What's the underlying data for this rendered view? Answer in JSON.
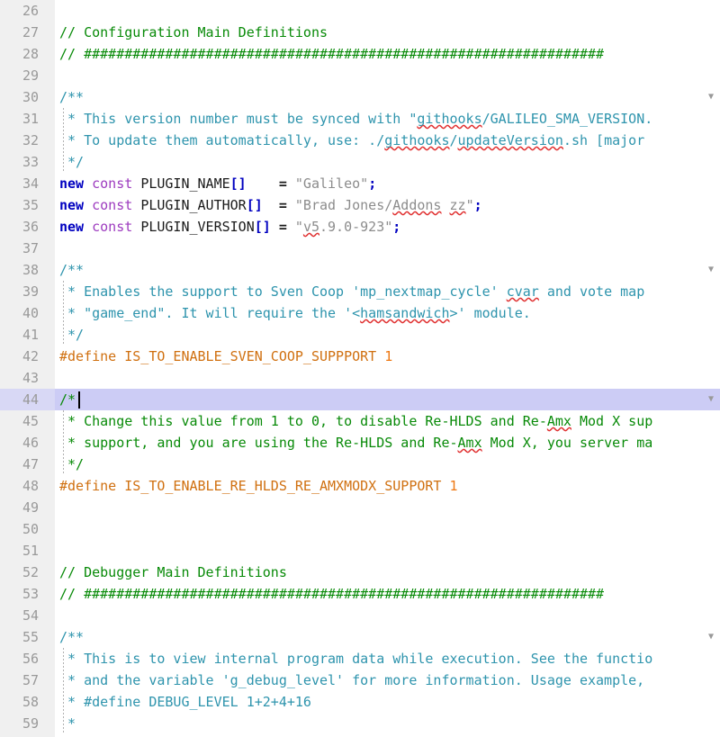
{
  "editor": {
    "name": "code-editor",
    "language": "Pawn / SourcePawn",
    "first_visible_line": 26,
    "last_visible_line": 59,
    "current_line": 44,
    "cursor": {
      "line": 44,
      "column": 3
    },
    "colors": {
      "background": "#ffffff",
      "gutter_background": "#f0f0f0",
      "gutter_text": "#999999",
      "current_line_highlight": "#ccccf5",
      "line_comment": "#088a08",
      "block_comment": "#088a08",
      "doc_comment": "#2e94ad",
      "keyword": "#0000c0",
      "const_keyword": "#9d3bbf",
      "identifier": "#1a1a1a",
      "string": "#8c8c8c",
      "preprocessor": "#d07010",
      "number": "#ee7711",
      "spellcheck_underline": "#e03030",
      "indent_guide": "#b0b0b0"
    }
  },
  "lines": [
    {
      "n": 26,
      "fold": false,
      "guide": false,
      "text": ""
    },
    {
      "n": 27,
      "fold": false,
      "guide": false,
      "text": "// Configuration Main Definitions"
    },
    {
      "n": 28,
      "fold": false,
      "guide": false,
      "text": "// ################################################################"
    },
    {
      "n": 29,
      "fold": false,
      "guide": false,
      "text": ""
    },
    {
      "n": 30,
      "fold": true,
      "guide": false,
      "text": "/**"
    },
    {
      "n": 31,
      "fold": false,
      "guide": true,
      "text": " * This version number must be synced with \"githooks/GALILEO_SMA_VERSION."
    },
    {
      "n": 32,
      "fold": false,
      "guide": true,
      "text": " * To update them automatically, use: ./githooks/updateVersion.sh [major"
    },
    {
      "n": 33,
      "fold": false,
      "guide": true,
      "text": " */"
    },
    {
      "n": 34,
      "fold": false,
      "guide": false,
      "text": "new const PLUGIN_NAME[]    = \"Galileo\";"
    },
    {
      "n": 35,
      "fold": false,
      "guide": false,
      "text": "new const PLUGIN_AUTHOR[]  = \"Brad Jones/Addons zz\";"
    },
    {
      "n": 36,
      "fold": false,
      "guide": false,
      "text": "new const PLUGIN_VERSION[] = \"v5.9.0-923\";"
    },
    {
      "n": 37,
      "fold": false,
      "guide": false,
      "text": ""
    },
    {
      "n": 38,
      "fold": true,
      "guide": false,
      "text": "/**"
    },
    {
      "n": 39,
      "fold": false,
      "guide": true,
      "text": " * Enables the support to Sven Coop 'mp_nextmap_cycle' cvar and vote map"
    },
    {
      "n": 40,
      "fold": false,
      "guide": true,
      "text": " * \"game_end\". It will require the '<hamsandwich>' module."
    },
    {
      "n": 41,
      "fold": false,
      "guide": true,
      "text": " */"
    },
    {
      "n": 42,
      "fold": false,
      "guide": false,
      "text": "#define IS_TO_ENABLE_SVEN_COOP_SUPPPORT 1"
    },
    {
      "n": 43,
      "fold": false,
      "guide": false,
      "text": ""
    },
    {
      "n": 44,
      "fold": true,
      "guide": false,
      "text": "/*"
    },
    {
      "n": 45,
      "fold": false,
      "guide": true,
      "text": " * Change this value from 1 to 0, to disable Re-HLDS and Re-Amx Mod X sup"
    },
    {
      "n": 46,
      "fold": false,
      "guide": true,
      "text": " * support, and you are using the Re-HLDS and Re-Amx Mod X, you server ma"
    },
    {
      "n": 47,
      "fold": false,
      "guide": true,
      "text": " */"
    },
    {
      "n": 48,
      "fold": false,
      "guide": false,
      "text": "#define IS_TO_ENABLE_RE_HLDS_RE_AMXMODX_SUPPORT 1"
    },
    {
      "n": 49,
      "fold": false,
      "guide": false,
      "text": ""
    },
    {
      "n": 50,
      "fold": false,
      "guide": false,
      "text": ""
    },
    {
      "n": 51,
      "fold": false,
      "guide": false,
      "text": ""
    },
    {
      "n": 52,
      "fold": false,
      "guide": false,
      "text": "// Debugger Main Definitions"
    },
    {
      "n": 53,
      "fold": false,
      "guide": false,
      "text": "// ################################################################"
    },
    {
      "n": 54,
      "fold": false,
      "guide": false,
      "text": ""
    },
    {
      "n": 55,
      "fold": true,
      "guide": false,
      "text": "/**"
    },
    {
      "n": 56,
      "fold": false,
      "guide": true,
      "text": " * This is to view internal program data while execution. See the functio"
    },
    {
      "n": 57,
      "fold": false,
      "guide": true,
      "text": " * and the variable 'g_debug_level' for more information. Usage example,"
    },
    {
      "n": 58,
      "fold": false,
      "guide": true,
      "text": " * #define DEBUG_LEVEL 1+2+4+16"
    },
    {
      "n": 59,
      "fold": false,
      "guide": true,
      "text": " *"
    }
  ],
  "icons": {
    "fold_arrow": "▼"
  },
  "spellchecked_words": [
    "githooks",
    "updateVersion",
    "Addons",
    "zz",
    "v5",
    "cvar",
    "hamsandwich",
    "Amx"
  ]
}
